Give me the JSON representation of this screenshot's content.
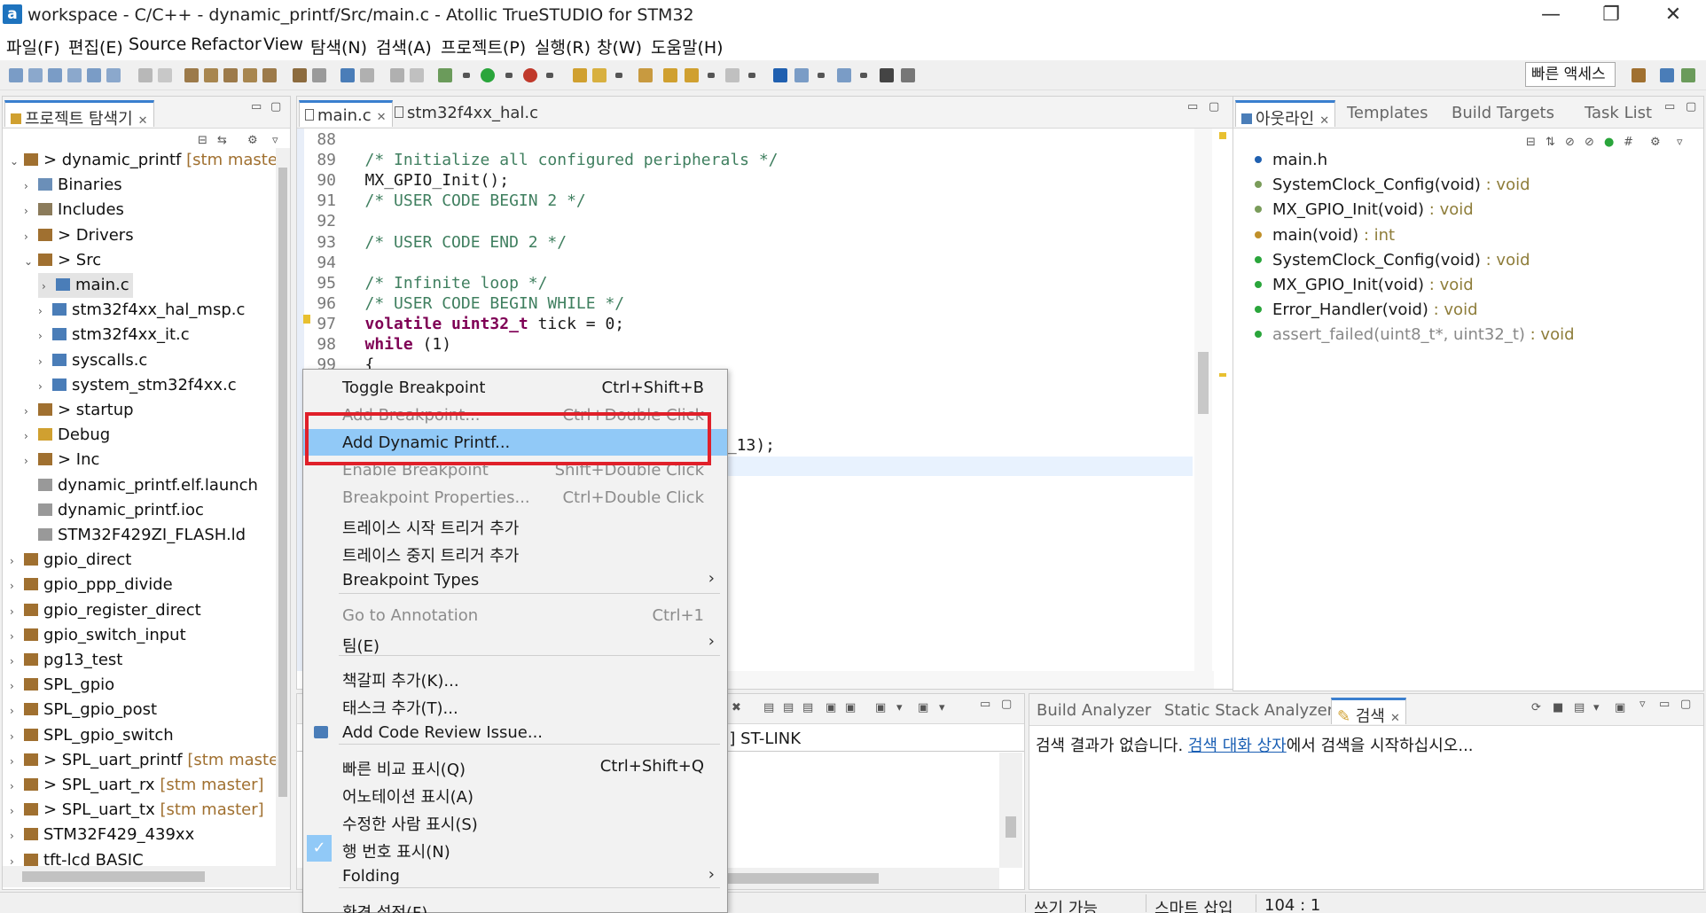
{
  "window": {
    "title": "workspace - C/C++ - dynamic_printf/Src/main.c - Atollic TrueSTUDIO for STM32",
    "app_icon": "a",
    "minimize": "—",
    "restore": "❐",
    "close": "✕"
  },
  "menubar": [
    "파일(F)",
    "편집(E)",
    "Source",
    "Refactor",
    "View",
    "탐색(N)",
    "검색(A)",
    "프로젝트(P)",
    "실행(R)",
    "창(W)",
    "도움말(H)"
  ],
  "toolbar": {
    "quick_access": "빠른 액세스"
  },
  "project_explorer": {
    "tab_label": "프로젝트 탐색기",
    "items": [
      {
        "label": "> dynamic_printf",
        "git": "[stm master]",
        "arrow": "⌄"
      },
      {
        "label": "Binaries",
        "arrow": "›"
      },
      {
        "label": "Includes",
        "arrow": "›"
      },
      {
        "label": "> Drivers",
        "arrow": "›"
      },
      {
        "label": "> Src",
        "arrow": "⌄"
      },
      {
        "label": "main.c",
        "arrow": "›"
      },
      {
        "label": "stm32f4xx_hal_msp.c",
        "arrow": "›"
      },
      {
        "label": "stm32f4xx_it.c",
        "arrow": "›"
      },
      {
        "label": "syscalls.c",
        "arrow": "›"
      },
      {
        "label": "system_stm32f4xx.c",
        "arrow": "›"
      },
      {
        "label": "> startup",
        "arrow": "›"
      },
      {
        "label": "Debug",
        "arrow": "›"
      },
      {
        "label": "> Inc",
        "arrow": "›"
      },
      {
        "label": "dynamic_printf.elf.launch",
        "arrow": ""
      },
      {
        "label": "dynamic_printf.ioc",
        "arrow": ""
      },
      {
        "label": "STM32F429ZI_FLASH.ld",
        "arrow": ""
      },
      {
        "label": "gpio_direct",
        "arrow": "›"
      },
      {
        "label": "gpio_ppp_divide",
        "arrow": "›"
      },
      {
        "label": "gpio_register_direct",
        "arrow": "›"
      },
      {
        "label": "gpio_switch_input",
        "arrow": "›"
      },
      {
        "label": "pg13_test",
        "arrow": "›"
      },
      {
        "label": "SPL_gpio",
        "arrow": "›"
      },
      {
        "label": "SPL_gpio_post",
        "arrow": "›"
      },
      {
        "label": "SPL_gpio_switch",
        "arrow": "›"
      },
      {
        "label": "> SPL_uart_printf",
        "git": "[stm master]",
        "arrow": "›"
      },
      {
        "label": "> SPL_uart_rx",
        "git": "[stm master]",
        "arrow": "›"
      },
      {
        "label": "> SPL_uart_tx",
        "git": "[stm master]",
        "arrow": "›"
      },
      {
        "label": "STM32F429_439xx",
        "arrow": "›"
      },
      {
        "label": "tft-lcd BASIC",
        "arrow": "›"
      }
    ]
  },
  "editor": {
    "tabs": [
      {
        "label": "main.c"
      },
      {
        "label": "stm32f4xx_hal.c"
      }
    ],
    "lines": [
      {
        "n": "88",
        "text": ""
      },
      {
        "n": "89",
        "text": "/* Initialize all configured peripherals */"
      },
      {
        "n": "90",
        "text": "MX_GPIO_Init();"
      },
      {
        "n": "91",
        "text": "/* USER CODE BEGIN 2 */"
      },
      {
        "n": "92",
        "text": ""
      },
      {
        "n": "93",
        "text": "/* USER CODE END 2 */"
      },
      {
        "n": "94",
        "text": ""
      },
      {
        "n": "95",
        "text": "/* Infinite loop */"
      },
      {
        "n": "96",
        "text": "/* USER CODE BEGIN WHILE */"
      },
      {
        "n": "97",
        "kw": "volatile uint32_t",
        "text": " tick = 0;"
      },
      {
        "n": "98",
        "kw": "while",
        "text": " (1)"
      },
      {
        "n": "99",
        "text": "{"
      }
    ],
    "visible_fragment": "N_13);"
  },
  "outline": {
    "tabs": [
      "아웃라인",
      "Templates",
      "Build Targets",
      "Task List"
    ],
    "items": [
      {
        "name": "main.h",
        "type": ""
      },
      {
        "name": "SystemClock_Config(void)",
        "type": " : void"
      },
      {
        "name": "MX_GPIO_Init(void)",
        "type": " : void"
      },
      {
        "name": "main(void)",
        "type": " : int"
      },
      {
        "name": "SystemClock_Config(void)",
        "type": " : void"
      },
      {
        "name": "MX_GPIO_Init(void)",
        "type": " : void"
      },
      {
        "name": "Error_Handler(void)",
        "type": " : void"
      },
      {
        "name": "assert_failed(uint8_t*, uint32_t)",
        "type": " : void"
      }
    ]
  },
  "console": {
    "text": "n] ST-LINK"
  },
  "search_panel": {
    "tabs": [
      "Build Analyzer",
      "Static Stack Analyzer",
      "검색"
    ],
    "message_prefix": "검색 결과가 없습니다. ",
    "link": "검색 대화 상자",
    "message_suffix": "에서 검색을 시작하십시오..."
  },
  "context_menu": {
    "items": [
      {
        "label": "Toggle Breakpoint",
        "accel": "Ctrl+Shift+B"
      },
      {
        "label": "Add Breakpoint...",
        "accel": "Ctrl+Double Click"
      },
      {
        "label": "Add Dynamic Printf...",
        "accel": ""
      },
      {
        "label": "Enable Breakpoint",
        "accel": "Shift+Double Click"
      },
      {
        "label": "Breakpoint Properties...",
        "accel": "Ctrl+Double Click"
      },
      {
        "label": "트레이스 시작 트리거 추가",
        "accel": ""
      },
      {
        "label": "트레이스 중지 트리거 추가",
        "accel": ""
      },
      {
        "label": "Breakpoint Types",
        "accel": ""
      },
      {
        "label": "Go to Annotation",
        "accel": "Ctrl+1"
      },
      {
        "label": "팀(E)",
        "accel": ""
      },
      {
        "label": "책갈피 추가(K)...",
        "accel": ""
      },
      {
        "label": "태스크 추가(T)...",
        "accel": ""
      },
      {
        "label": "Add Code Review Issue...",
        "accel": ""
      },
      {
        "label": "빠른 비교 표시(Q)",
        "accel": "Ctrl+Shift+Q"
      },
      {
        "label": "어노테이션 표시(A)",
        "accel": ""
      },
      {
        "label": "수정한 사람 표시(S)",
        "accel": ""
      },
      {
        "label": "행 번호 표시(N)",
        "accel": ""
      },
      {
        "label": "Folding",
        "accel": ""
      },
      {
        "label": "환경 설정(F)...",
        "accel": ""
      }
    ],
    "check_mark": "✓",
    "submenu_arrow": "›"
  },
  "statusbar": {
    "writable": "쓰기 가능",
    "insert_mode": "스마트 삽입",
    "position": "104 : 1"
  },
  "colors": {
    "accent": "#3a7fcf",
    "selection": "#91c9f7",
    "highlight_box": "#e0202a"
  }
}
